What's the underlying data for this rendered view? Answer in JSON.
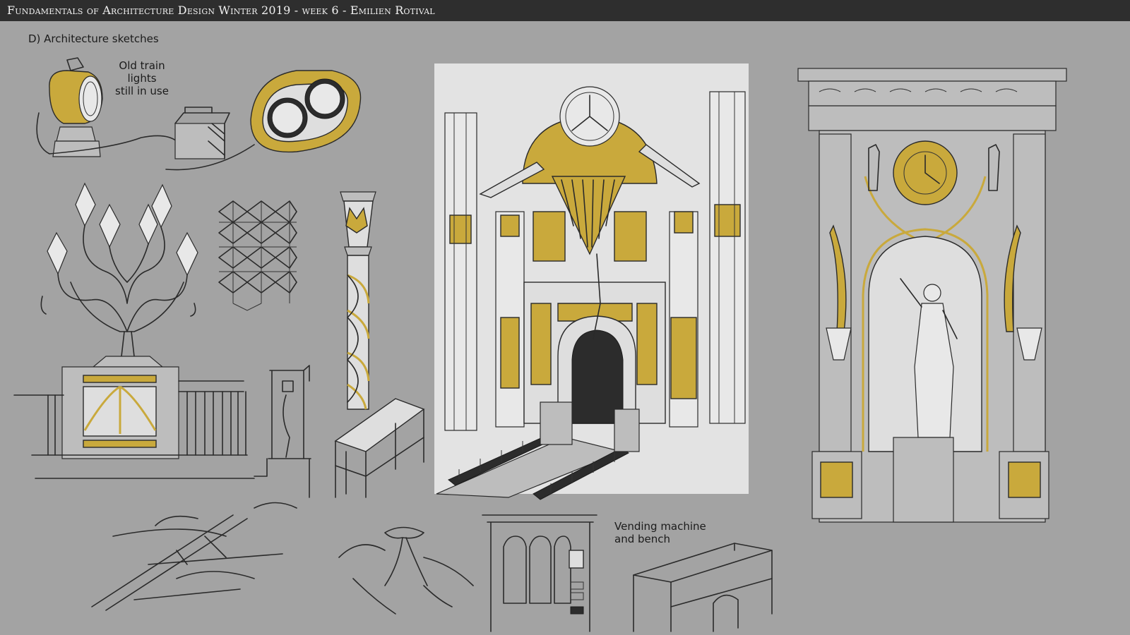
{
  "header": {
    "title": "Fundamentals of Architecture Design Winter 2019 - week 6 - Emilien Rotival"
  },
  "sheet": {
    "section_title": "D) Architecture sketches",
    "notes": {
      "train_lights": "Old train lights\nstill in use",
      "vending": "Vending machine\nand bench"
    }
  },
  "colors": {
    "background": "#a3a3a3",
    "titlebar": "#2e2e2e",
    "accent_gold": "#c9a93c",
    "ink": "#2a2a2a"
  }
}
